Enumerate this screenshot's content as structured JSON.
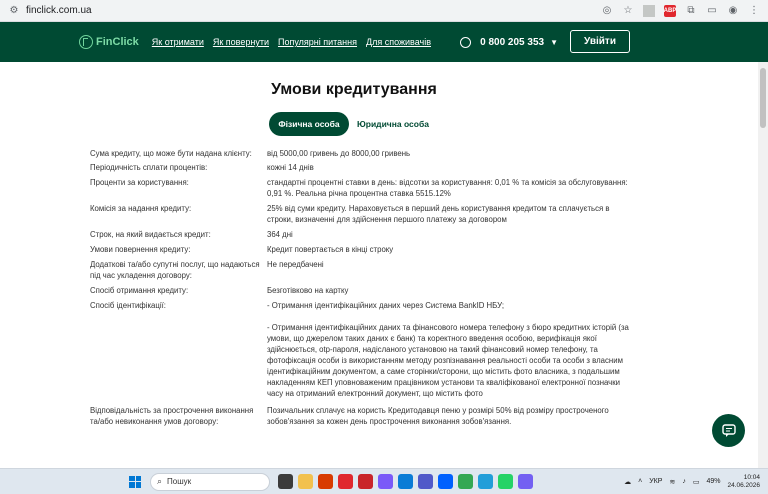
{
  "browser": {
    "url": "finclick.com.ua",
    "site_icon": "site-settings-icon",
    "abp_label": "ABP"
  },
  "header": {
    "logo_text": "FinClick",
    "nav": [
      "Як отримати",
      "Як повернути",
      "Популярні питання",
      "Для споживачів"
    ],
    "phone": "0 800 205 353",
    "login_label": "Увійти"
  },
  "main": {
    "title": "Умови кредитування",
    "tabs": [
      "Фізична особа",
      "Юридична особа"
    ],
    "active_tab": "Фізична особа",
    "terms": [
      {
        "label": "Сума кредиту, що може бути надана клієнту:",
        "value": "від 5000,00 гривень до 8000,00 гривень"
      },
      {
        "label": "Періодичність сплати процентів:",
        "value": "кожні 14 днів"
      },
      {
        "label": "Проценти за користування:",
        "value": "стандартні процентні ставки в день: відсотки за користування: 0,01 % та комісія за обслуговування: 0,91 %. Реальна річна процентна ставка 5515.12%"
      },
      {
        "label": "Комісія за надання кредиту:",
        "value": "25% від суми кредиту. Нараховується в перший день користування кредитом та сплачується в строки, визначенні для здійснення першого платежу за договором"
      },
      {
        "label": "Строк, на який видається кредит:",
        "value": "364 дні"
      },
      {
        "label": "Умови повернення кредиту:",
        "value": "Кредит повертається в кінці строку"
      },
      {
        "label": "Додаткові та/або супутні послуг, що надаються під час укладення договору:",
        "value": "Не передбачені"
      },
      {
        "label": "Спосіб отримання кредиту:",
        "value": "Безготівково на картку"
      },
      {
        "label": "Спосіб ідентифікації:",
        "value": "- Отримання ідентифікаційних даних через Система BankID НБУ;"
      },
      {
        "label": "",
        "value": "- Отримання ідентифікаційних даних та фінансового номера телефону з бюро кредитних історій (за умови, що джерелом таких даних є банк) та коректного введення особою, верифікація якої здійснюється, otp-пароля, надісланого установою на такий фінансовий номер телефону, та фотофіксація особи із використанням методу розпізнавання реальності особи та особи з власним ідентифікаційним документом, а саме сторінки/сторони, що містить фото власника, з подальшим накладенням КЕП уповноваженим працівником установи та кваліфікованої електронної позначки часу на отриманий електронний документ, що містить фото"
      },
      {
        "label": "Відповідальність за прострочення виконання та/або невиконання умов договору:",
        "value": "Позичальник сплачує на користь Кредитодавця пеню у розмірі 50% від розміру простроченого зобов'язання за кожен день прострочення виконання зобов'язання."
      }
    ]
  },
  "taskbar": {
    "search_placeholder": "Пошук",
    "lang": "УКР",
    "battery": "49%",
    "time": "10:04",
    "date": "24.06.2026"
  }
}
